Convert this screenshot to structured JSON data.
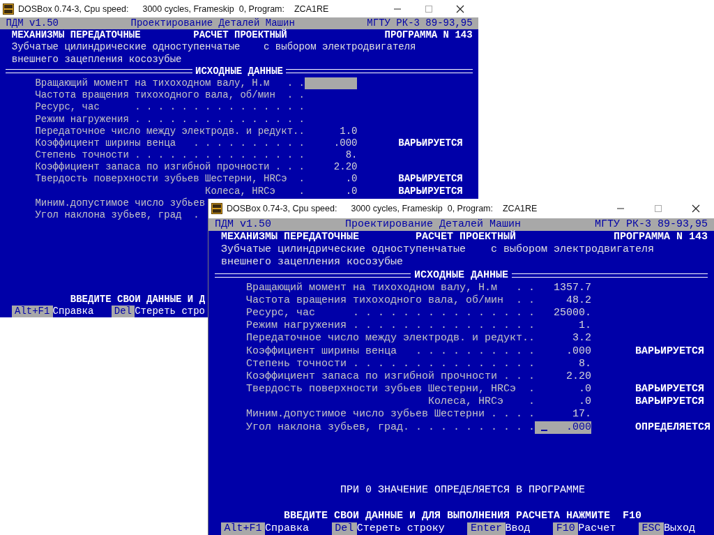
{
  "windows": [
    {
      "title": {
        "app": "DOSBox 0.74-3, Cpu speed:",
        "speed": "3000 cycles, Frameskip  0, Program:",
        "program": "ZCA1RE"
      },
      "header": {
        "left": "ПДМ v1.50",
        "center": "Проектирование Деталей Машин",
        "right": "МГТУ РК-3 89-93,95"
      },
      "heading": {
        "left": "МЕХАНИЗМЫ ПЕРЕДАТОЧНЫЕ",
        "center": "РАСЧЕТ ПРОЕКТНЫЙ",
        "right": "ПРОГРАММА N 143"
      },
      "subtitle": {
        "left": "Зубчатые цилиндрические одноступенчатые",
        "right": "с выбором электродвигателя",
        "second_line": "внешнего зацепления косозубые"
      },
      "section_title": "ИСХОДНЫЕ ДАННЫЕ",
      "rows": [
        {
          "kind": "main",
          "label": "Вращающий момент на тихоходном валу, Н.м",
          "dots": ". .",
          "active": true,
          "caret": false
        },
        {
          "kind": "main",
          "label": "Частота вращения тихоходного вала, об/мин",
          "dots": ". .",
          "active": false,
          "caret": false
        },
        {
          "kind": "main",
          "label": "Ресурс, час",
          "dots": ". . . . . . . . . . . . . . .",
          "active": false,
          "caret": false
        },
        {
          "kind": "main",
          "label": "Режим нагружения",
          "dots": ". . . . . . . . . . . . . . .",
          "active": false,
          "caret": false
        },
        {
          "kind": "main",
          "label": "Передаточное число между электродв. и редукт..",
          "value": "1.0",
          "active": false,
          "caret": false
        },
        {
          "kind": "main",
          "label": "Коэффициент ширины венца",
          "dots": ". . . . . . . . . .",
          "value": ".000",
          "note": "ВАРЬИРУЕТСЯ",
          "active": false,
          "caret": false
        },
        {
          "kind": "main",
          "label": "Степень точности",
          "dots": ". . . . . . . . . . . . . . .",
          "value": "8.",
          "active": false,
          "caret": false
        },
        {
          "kind": "main",
          "label": "Коэффициент запаса по изгибной прочности",
          "dots": ". . .",
          "value": "2.20",
          "active": false,
          "caret": false
        },
        {
          "kind": "main",
          "label": "Твердость поверхности зубьев Шестерни, HRCэ",
          "dots": ".",
          "value": ".0",
          "note": "ВАРЬИРУЕТСЯ",
          "active": false,
          "caret": false
        },
        {
          "kind": "sub",
          "label": "Колеса, HRCэ",
          "dots": ".",
          "value": ".0",
          "note": "ВАРЬИРУЕТСЯ",
          "active": false,
          "caret": false
        },
        {
          "kind": "clipped",
          "label": "Миним.допустимое число зубьев"
        },
        {
          "kind": "clipped",
          "label": "Угол наклона зубьев, град",
          "dots": "."
        }
      ],
      "prompt": "ВВЕДИТЕ СВОИ ДАННЫЕ И Д",
      "keys": [
        {
          "key": "Alt+F1",
          "action": "Справка"
        },
        {
          "key": "Del",
          "action": "Стереть стро"
        }
      ]
    },
    {
      "title": {
        "app": "DOSBox 0.74-3, Cpu speed:",
        "speed": "3000 cycles, Frameskip  0, Program:",
        "program": "ZCA1RE"
      },
      "header": {
        "left": "ПДМ v1.50",
        "center": "Проектирование Деталей Машин",
        "right": "МГТУ РК-3 89-93,95"
      },
      "heading": {
        "left": "МЕХАНИЗМЫ ПЕРЕДАТОЧНЫЕ",
        "center": "РАСЧЕТ ПРОЕКТНЫЙ",
        "right": "ПРОГРАММА N 143"
      },
      "subtitle": {
        "left": "Зубчатые цилиндрические одноступенчатые",
        "right": "с выбором электродвигателя",
        "second_line": "внешнего зацепления косозубые"
      },
      "section_title": "ИСХОДНЫЕ ДАННЫЕ",
      "rows": [
        {
          "kind": "main",
          "label": "Вращающий момент на тихоходном валу, Н.м",
          "dots": ". .",
          "value": "1357.7",
          "active": false,
          "caret": false
        },
        {
          "kind": "main",
          "label": "Частота вращения тихоходного вала, об/мин",
          "dots": ". .",
          "value": "48.2",
          "active": false,
          "caret": false
        },
        {
          "kind": "main",
          "label": "Ресурс, час",
          "dots": ". . . . . . . . . . . . . . .",
          "value": "25000.",
          "active": false,
          "caret": false
        },
        {
          "kind": "main",
          "label": "Режим нагружения",
          "dots": ". . . . . . . . . . . . . . .",
          "value": "1.",
          "active": false,
          "caret": false
        },
        {
          "kind": "main",
          "label": "Передаточное число между электродв. и редукт..",
          "value": "3.2",
          "active": false,
          "caret": false
        },
        {
          "kind": "main",
          "label": "Коэффициент ширины венца",
          "dots": ". . . . . . . . . .",
          "value": ".000",
          "note": "ВАРЬИРУЕТСЯ",
          "active": false,
          "caret": false
        },
        {
          "kind": "main",
          "label": "Степень точности",
          "dots": ". . . . . . . . . . . . . . .",
          "value": "8.",
          "active": false,
          "caret": false
        },
        {
          "kind": "main",
          "label": "Коэффициент запаса по изгибной прочности",
          "dots": ". . .",
          "value": "2.20",
          "active": false,
          "caret": false
        },
        {
          "kind": "main",
          "label": "Твердость поверхности зубьев Шестерни, HRCэ",
          "dots": ".",
          "value": ".0",
          "note": "ВАРЬИРУЕТСЯ",
          "active": false,
          "caret": false
        },
        {
          "kind": "sub",
          "label": "Колеса, HRCэ",
          "dots": ".",
          "value": ".0",
          "note": "ВАРЬИРУЕТСЯ",
          "active": false,
          "caret": false
        },
        {
          "kind": "main",
          "label": "Миним.допустимое число зубьев Шестерни",
          "dots": ". . . .",
          "value": "17.",
          "active": false,
          "caret": false
        },
        {
          "kind": "main",
          "label": "Угол наклона зубьев, град",
          "dots": ". . . . . . . . . . .",
          "value": ".000",
          "note": "ОПРЕДЕЛЯЕТСЯ",
          "active": true,
          "caret": true
        }
      ],
      "hint": "ПРИ 0 ЗНАЧЕНИЕ ОПРЕДЕЛЯЕТСЯ В ПРОГРАММЕ",
      "prompt": "ВВЕДИТЕ СВОИ ДАННЫЕ И ДЛЯ ВЫПОЛНЕНИЯ РАСЧЕТА НАЖМИТЕ  F10",
      "keys": [
        {
          "key": "Alt+F1",
          "action": "Справка"
        },
        {
          "key": "Del",
          "action": "Стереть строку"
        },
        {
          "key": "Enter",
          "action": "Ввод"
        },
        {
          "key": "F10",
          "action": "Расчет"
        },
        {
          "key": "ESC",
          "action": "Выход"
        }
      ]
    }
  ]
}
